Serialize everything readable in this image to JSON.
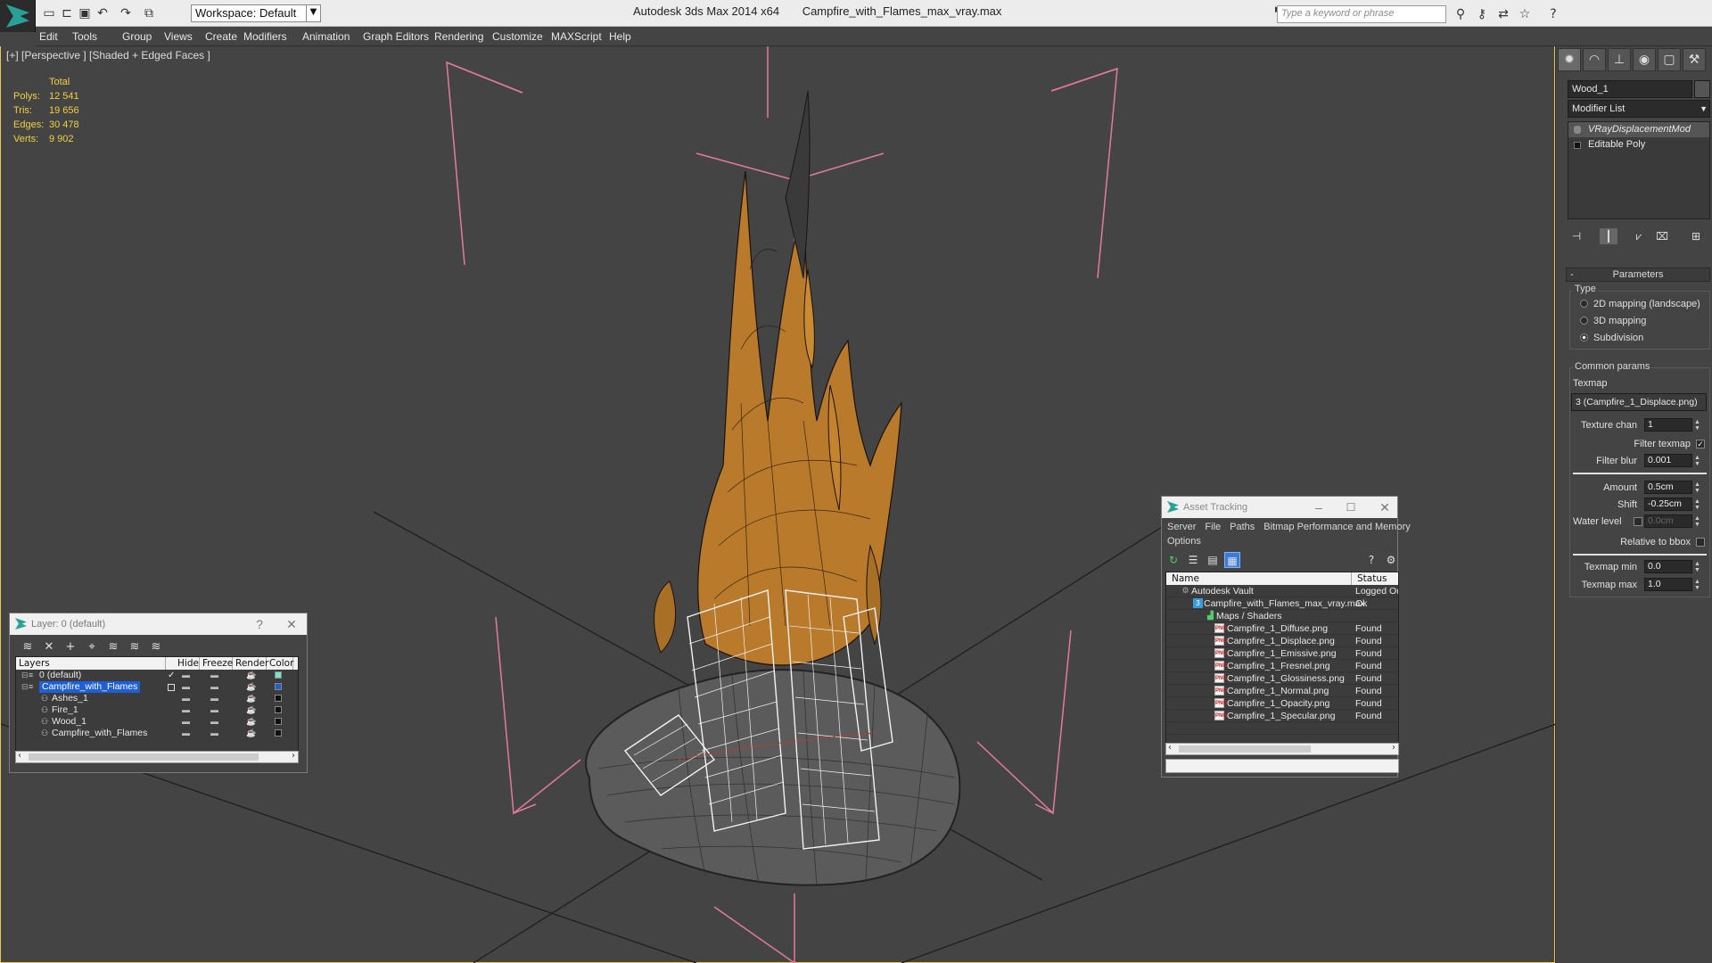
{
  "titlebar": {
    "workspace": "Workspace: Default",
    "app_name": "Autodesk 3ds Max  2014 x64",
    "file_name": "Campfire_with_Flames_max_vray.max",
    "search_placeholder": "Type a keyword or phrase",
    "minimize": "–",
    "maximize": "□",
    "close": "✕"
  },
  "menu": [
    "Edit",
    "Tools",
    "Group",
    "Views",
    "Create",
    "Modifiers",
    "Animation",
    "Graph Editors",
    "Rendering",
    "Customize",
    "MAXScript",
    "Help"
  ],
  "viewport": {
    "label": "[+] [Perspective ] [Shaded + Edged Faces ]",
    "stats": {
      "header": "Total",
      "rows": [
        {
          "label": "Polys:",
          "value": "12 541"
        },
        {
          "label": "Tris:",
          "value": "19 656"
        },
        {
          "label": "Edges:",
          "value": "30 478"
        },
        {
          "label": "Verts:",
          "value": "9 902"
        }
      ]
    },
    "colors": {
      "background": "#444444",
      "border": "#e8c75a",
      "bbox": "#e27aa0",
      "stats": "#f0d23c"
    }
  },
  "command_panel": {
    "object_name": "Wood_1",
    "modifier_list": "Modifier List",
    "stack": [
      {
        "label": "VRayDisplacementMod",
        "selected": true
      },
      {
        "label": "Editable Poly",
        "selected": false
      }
    ],
    "parameters": {
      "title": "Parameters",
      "type_group": "Type",
      "type_options": [
        {
          "label": "2D mapping (landscape)",
          "selected": false
        },
        {
          "label": "3D mapping",
          "selected": false
        },
        {
          "label": "Subdivision",
          "selected": true
        }
      ],
      "common_group": "Common params",
      "texmap_label": "Texmap",
      "texmap_value": "3 (Campfire_1_Displace.png)",
      "texture_chan_label": "Texture chan",
      "texture_chan_value": "1",
      "filter_texmap_label": "Filter texmap",
      "filter_blur_label": "Filter blur",
      "filter_blur_value": "0.001",
      "amount_label": "Amount",
      "amount_value": "0.5cm",
      "shift_label": "Shift",
      "shift_value": "-0.25cm",
      "water_level_label": "Water level",
      "water_level_value": "0.0cm",
      "relative_bbox_label": "Relative to bbox",
      "texmap_min_label": "Texmap min",
      "texmap_min_value": "0.0",
      "texmap_max_label": "Texmap max",
      "texmap_max_value": "1.0"
    }
  },
  "layer_dialog": {
    "title": "Layer: 0 (default)",
    "help": "?",
    "close": "✕",
    "columns": [
      "Layers",
      "Hide",
      "Freeze",
      "Render",
      "Color"
    ],
    "rows": [
      {
        "name": "0 (default)",
        "indent": 0,
        "selected": false,
        "current": true,
        "color": "#7fe0c8"
      },
      {
        "name": "Campfire_with_Flames",
        "indent": 0,
        "selected": true,
        "current": false,
        "color": "#1e5fd8"
      },
      {
        "name": "Ashes_1",
        "indent": 1,
        "selected": false,
        "current": false,
        "color": "#111111"
      },
      {
        "name": "Fire_1",
        "indent": 1,
        "selected": false,
        "current": false,
        "color": "#111111"
      },
      {
        "name": "Wood_1",
        "indent": 1,
        "selected": false,
        "current": false,
        "color": "#111111"
      },
      {
        "name": "Campfire_with_Flames",
        "indent": 1,
        "selected": false,
        "current": false,
        "color": "#111111"
      }
    ]
  },
  "asset_tracking": {
    "title": "Asset Tracking",
    "menu_row1": [
      "Server",
      "File",
      "Paths",
      "Bitmap Performance and Memory"
    ],
    "menu_row2": [
      "Options"
    ],
    "columns": [
      "Name",
      "Status"
    ],
    "rows": [
      {
        "name": "Autodesk Vault",
        "status": "Logged Ou",
        "icon": "vault-icon"
      },
      {
        "name": "Campfire_with_Flames_max_vray.max",
        "status": "Ok",
        "icon": "max-file-icon"
      },
      {
        "name": "Maps / Shaders",
        "status": "",
        "icon": "maps-icon"
      },
      {
        "name": "Campfire_1_Diffuse.png",
        "status": "Found",
        "icon": "png-icon"
      },
      {
        "name": "Campfire_1_Displace.png",
        "status": "Found",
        "icon": "png-icon"
      },
      {
        "name": "Campfire_1_Emissive.png",
        "status": "Found",
        "icon": "png-icon"
      },
      {
        "name": "Campfire_1_Fresnel.png",
        "status": "Found",
        "icon": "png-icon"
      },
      {
        "name": "Campfire_1_Glossiness.png",
        "status": "Found",
        "icon": "png-icon"
      },
      {
        "name": "Campfire_1_Normal.png",
        "status": "Found",
        "icon": "png-icon"
      },
      {
        "name": "Campfire_1_Opacity.png",
        "status": "Found",
        "icon": "png-icon"
      },
      {
        "name": "Campfire_1_Specular.png",
        "status": "Found",
        "icon": "png-icon"
      }
    ]
  }
}
